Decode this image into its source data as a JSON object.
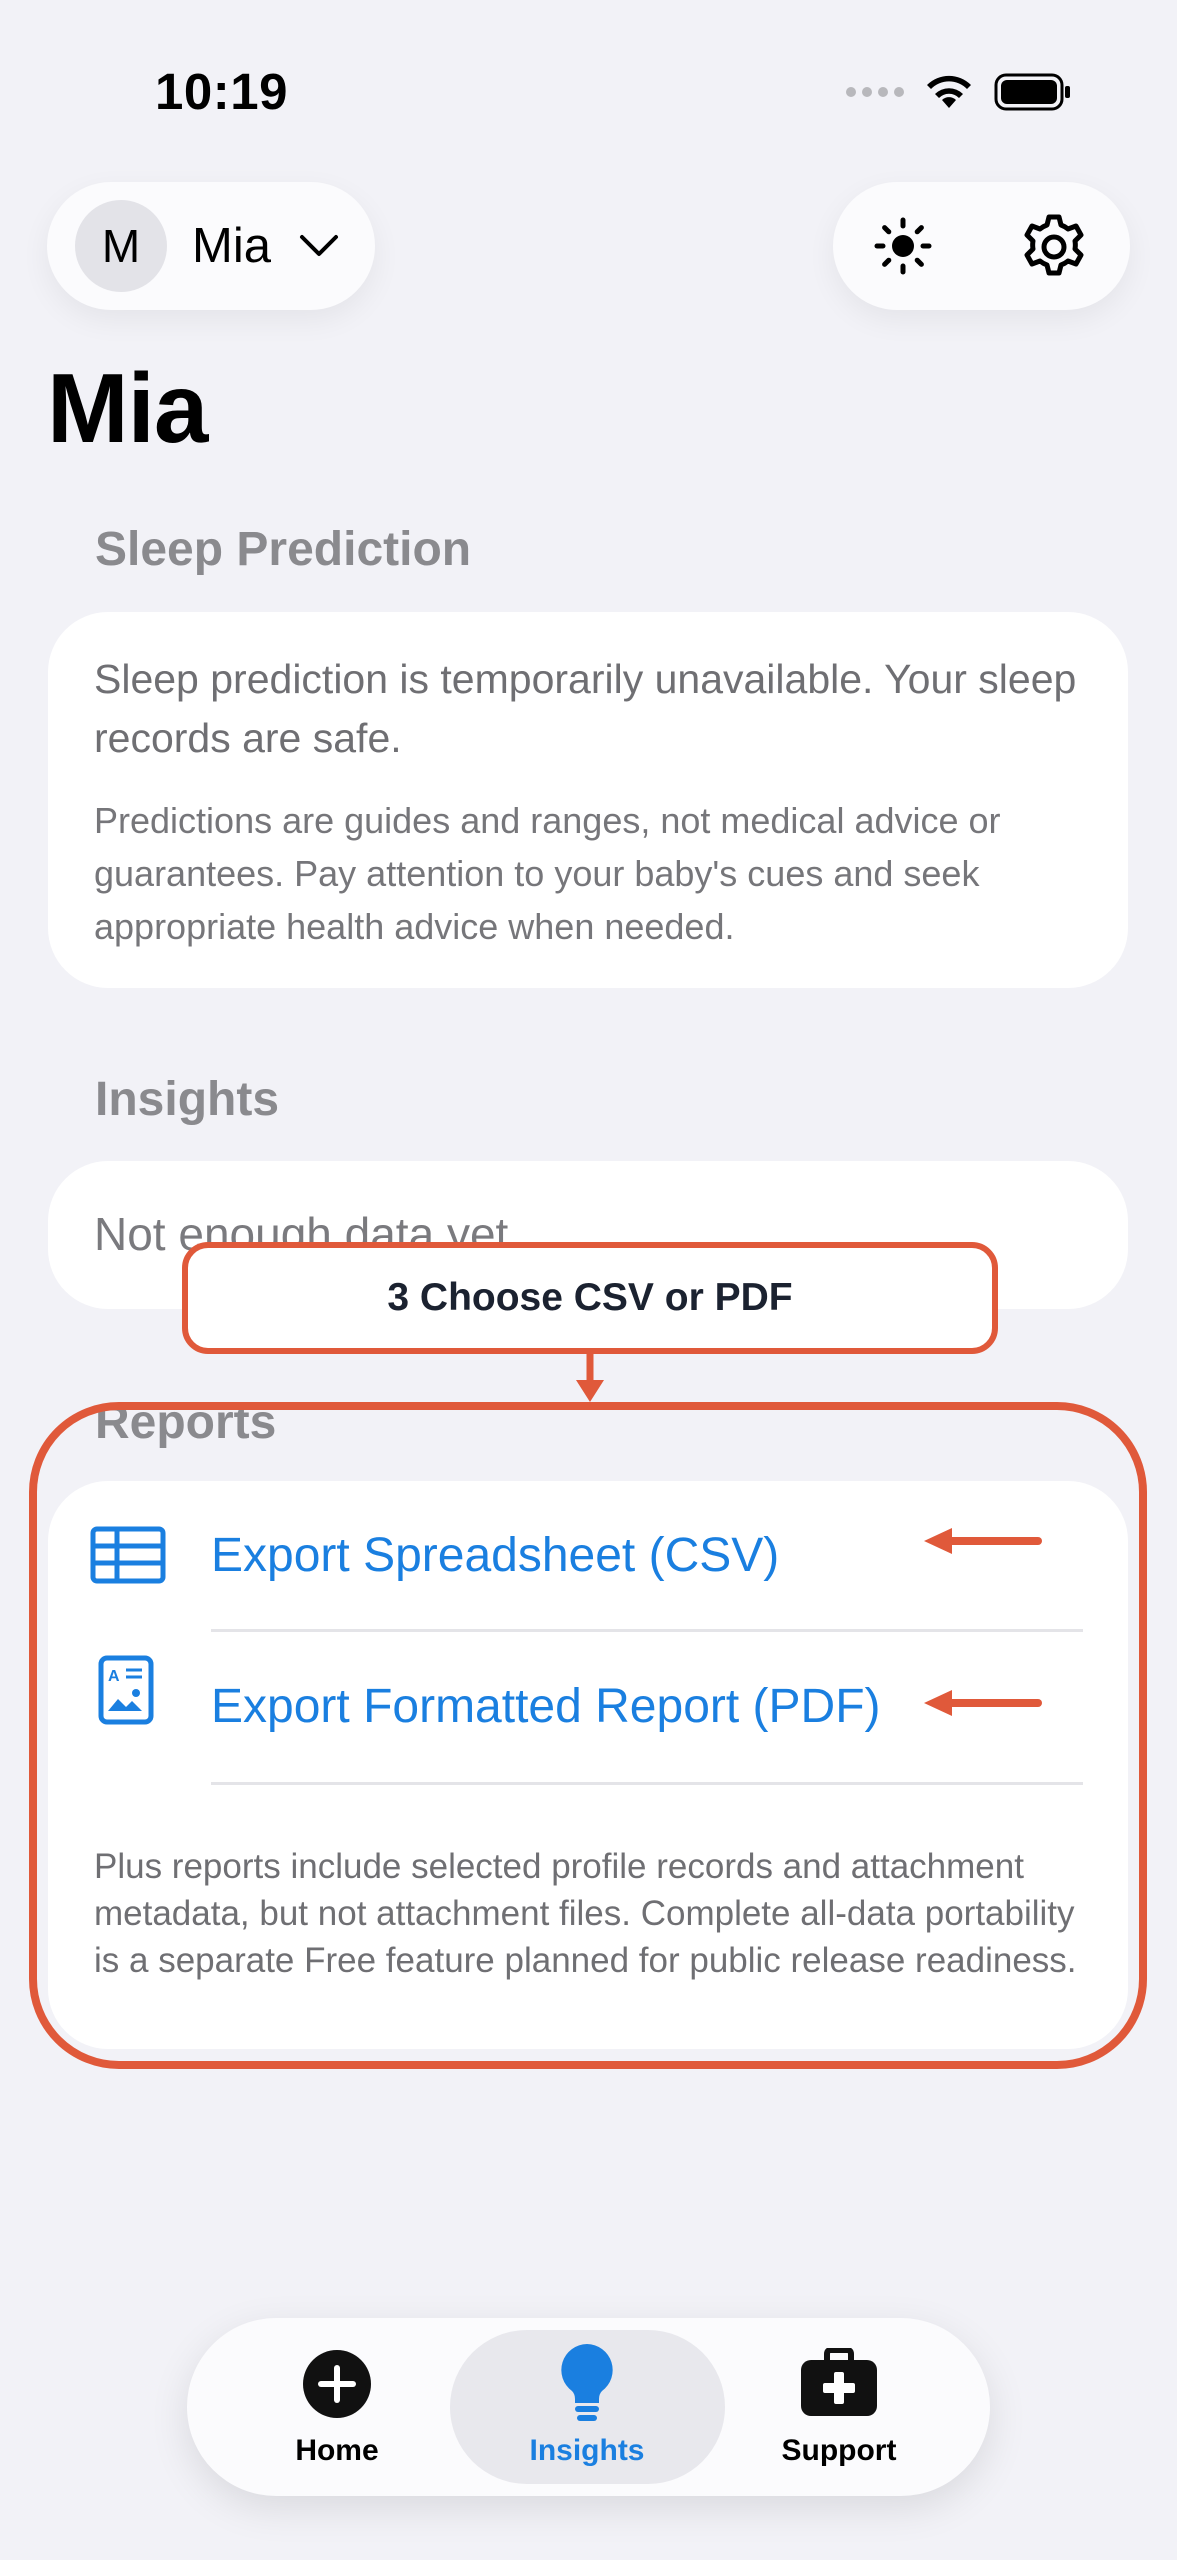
{
  "status": {
    "time": "10:19"
  },
  "profile": {
    "initial": "M",
    "name": "Mia"
  },
  "page": {
    "title": "Mia"
  },
  "sleep_prediction": {
    "header": "Sleep Prediction",
    "message": "Sleep prediction is temporarily unavailable. Your sleep records are safe.",
    "note": "Predictions are guides and ranges, not medical advice or guarantees. Pay attention to your baby's cues and seek appropriate health advice when needed."
  },
  "insights": {
    "header": "Insights",
    "message": "Not enough data yet"
  },
  "reports": {
    "header": "Reports",
    "rows": [
      {
        "label": "Export Spreadsheet (CSV)",
        "icon": "table-icon"
      },
      {
        "label": "Export Formatted Report (PDF)",
        "icon": "document-icon"
      }
    ],
    "note": "Plus reports include selected profile records and attachment metadata, but not attachment files. Complete all-data portability is a separate Free feature planned for public release readiness."
  },
  "annotation": {
    "callout": "3  Choose CSV or PDF",
    "color": "#e0593a"
  },
  "tabbar": {
    "tabs": [
      {
        "label": "Home",
        "icon": "plus-circle-icon",
        "active": false
      },
      {
        "label": "Insights",
        "icon": "lightbulb-icon",
        "active": true
      },
      {
        "label": "Support",
        "icon": "medical-kit-icon",
        "active": false
      }
    ]
  },
  "colors": {
    "accent": "#1a7fe0",
    "background": "#f2f2f7",
    "annotation": "#e0593a"
  }
}
